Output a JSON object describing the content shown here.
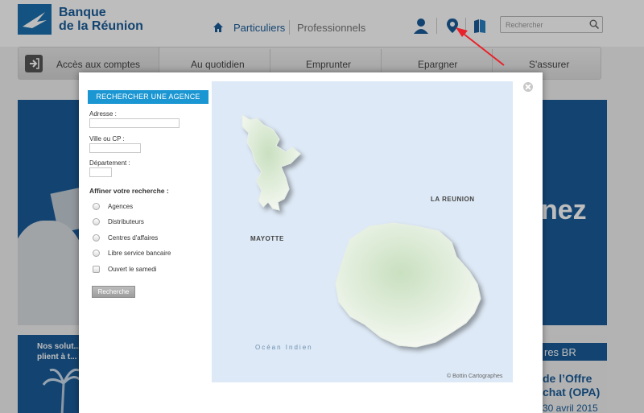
{
  "brand": {
    "line1": "Banque",
    "line2": "de la Réunion",
    "logo_icon": "bird-logo-icon"
  },
  "nav": {
    "particuliers": "Particuliers",
    "professionnels": "Professionnels"
  },
  "search": {
    "placeholder": "Rechercher"
  },
  "menu": {
    "items": [
      "Accès aux comptes",
      "Au quotidien",
      "Emprunter",
      "Epargner",
      "S'assurer"
    ]
  },
  "banner": {
    "right_text": "nez"
  },
  "promo_left": {
    "text": "Nos solut... se plient à t..."
  },
  "promo_right": {
    "header": "res BR",
    "line1": "de l’Offre",
    "line2": "chat (OPA)",
    "line3": "30 avril 2015"
  },
  "modal": {
    "title": "RECHERCHER UNE AGENCE",
    "adresse_label": "Adresse :",
    "ville_label": "Ville ou CP :",
    "departement_label": "Département :",
    "refine_label": "Affiner votre recherche :",
    "options": [
      "Agences",
      "Distributeurs",
      "Centres d'affaires",
      "Libre service bancaire",
      "Ouvert le samedi"
    ],
    "search_button": "Recherche"
  },
  "map": {
    "label_reunion": "LA REUNION",
    "label_mayotte": "MAYOTTE",
    "ocean": "Océan Indien",
    "credit": "© Bottin Cartographes"
  },
  "colors": {
    "brand_blue": "#1a5c99",
    "accent_blue": "#1a96d2",
    "arrow_red": "#e8222a"
  }
}
